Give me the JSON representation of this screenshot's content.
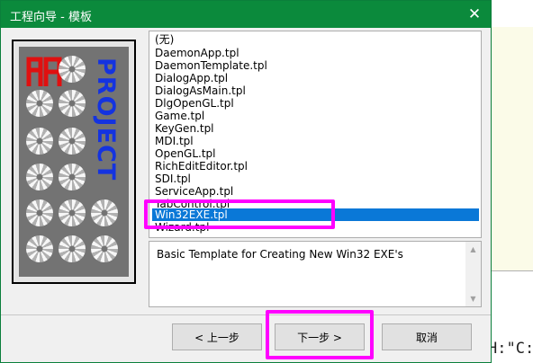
{
  "window": {
    "title": "工程向导 - 模板",
    "close_glyph": "✕"
  },
  "templates": {
    "items": [
      "(无)",
      "DaemonApp.tpl",
      "DaemonTemplate.tpl",
      "DialogApp.tpl",
      "DialogAsMain.tpl",
      "DlgOpenGL.tpl",
      "Game.tpl",
      "KeyGen.tpl",
      "MDI.tpl",
      "OpenGL.tpl",
      "RichEditEditor.tpl",
      "SDI.tpl",
      "ServiceApp.tpl",
      "TabControl.tpl",
      "Win32EXE.tpl",
      "Wizard.tpl"
    ],
    "selected": "Win32EXE.tpl"
  },
  "description": "Basic Template for Creating New Win32 EXE's",
  "logo": {
    "word": "PROJECT",
    "brand_color": "#1433e0",
    "mark_color": "#e01010"
  },
  "buttons": {
    "back": "< 上一步",
    "next": "下一步 >",
    "cancel": "取消"
  },
  "background": {
    "left_fragment": "y",
    "right_fragment": "H:\"C:\\"
  },
  "colors": {
    "titlebar": "#0b8a3c",
    "selection": "#0a78d7",
    "highlight": "#ff00ff"
  }
}
